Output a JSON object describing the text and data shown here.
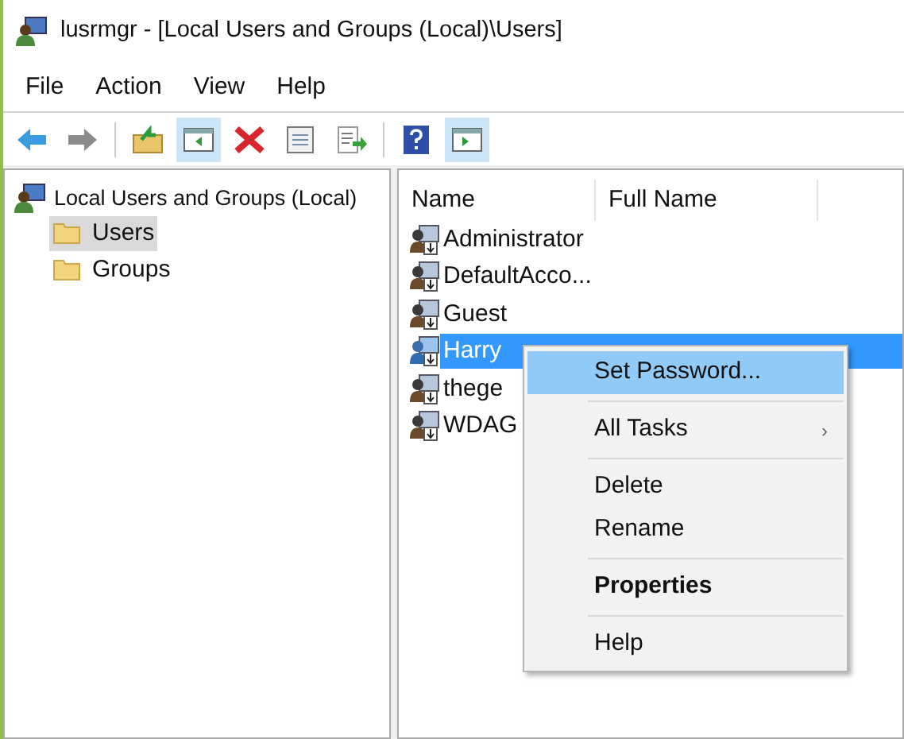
{
  "window": {
    "title": "lusrmgr - [Local Users and Groups (Local)\\Users]"
  },
  "menu_bar": [
    "File",
    "Action",
    "View",
    "Help"
  ],
  "toolbar_buttons": [
    {
      "disabled": false,
      "pressed": false
    },
    {
      "disabled": true,
      "pressed": false
    },
    {
      "disabled": false,
      "pressed": false
    },
    {
      "disabled": false,
      "pressed": true
    },
    {
      "disabled": false,
      "pressed": false
    },
    {
      "disabled": false,
      "pressed": false
    },
    {
      "disabled": false,
      "pressed": false
    },
    {
      "disabled": false,
      "pressed": false
    },
    {
      "disabled": false,
      "pressed": true
    }
  ],
  "tree": {
    "label": "Local Users and Groups (Local)",
    "children": [
      {
        "label": "Users",
        "selected": true
      },
      {
        "label": "Groups",
        "selected": false
      }
    ]
  },
  "table": {
    "columns": [
      "Name",
      "Full Name"
    ],
    "rows": [
      {
        "name": "Administrator",
        "selected": false
      },
      {
        "name": "DefaultAcco...",
        "selected": false
      },
      {
        "name": "Guest",
        "selected": false
      },
      {
        "name": "Harry",
        "selected": true
      },
      {
        "name": "thege",
        "selected": false
      },
      {
        "name": "WDAG",
        "selected": false
      }
    ]
  },
  "context_menu": [
    {
      "kind": "item",
      "label": "Set Password...",
      "selected": true,
      "default": false
    },
    {
      "kind": "separator"
    },
    {
      "kind": "item",
      "label": "All Tasks",
      "selected": false,
      "default": false,
      "arrow": "›"
    },
    {
      "kind": "separator"
    },
    {
      "kind": "item",
      "label": "Delete",
      "selected": false,
      "default": false
    },
    {
      "kind": "item",
      "label": "Rename",
      "selected": false,
      "default": false
    },
    {
      "kind": "separator"
    },
    {
      "kind": "item",
      "label": "Properties",
      "selected": false,
      "default": true
    },
    {
      "kind": "separator"
    },
    {
      "kind": "item",
      "label": "Help",
      "selected": false,
      "default": false
    }
  ]
}
